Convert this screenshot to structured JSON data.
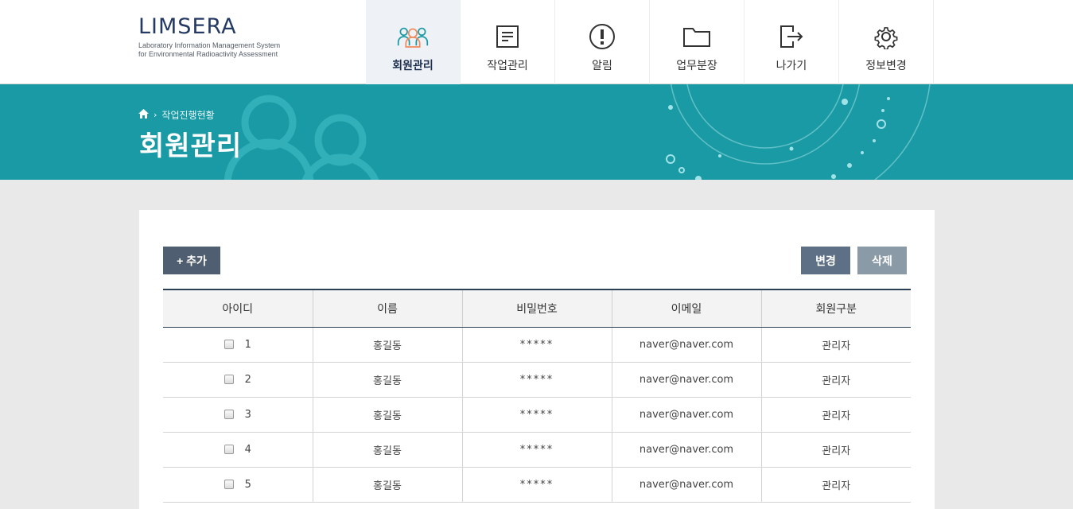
{
  "logo": {
    "title": "LIMSERA",
    "subtitle_line1": "Laboratory Information Management System",
    "subtitle_line2": "for Environmental Radioactivity Assessment"
  },
  "nav": [
    {
      "label": "회원관리",
      "icon": "users-icon",
      "active": true
    },
    {
      "label": "작업관리",
      "icon": "document-icon",
      "active": false
    },
    {
      "label": "알림",
      "icon": "alert-icon",
      "active": false
    },
    {
      "label": "업무분장",
      "icon": "folder-icon",
      "active": false
    },
    {
      "label": "나가기",
      "icon": "logout-icon",
      "active": false
    },
    {
      "label": "정보변경",
      "icon": "gear-icon",
      "active": false
    }
  ],
  "breadcrumb": {
    "home_icon": "home-icon",
    "current": "작업진행현황"
  },
  "page_title": "회원관리",
  "toolbar": {
    "add_label": "+ 추가",
    "edit_label": "변경",
    "delete_label": "삭제"
  },
  "table": {
    "headers": [
      "아이디",
      "이름",
      "비밀번호",
      "이메일",
      "회원구분"
    ],
    "rows": [
      {
        "id": "1",
        "name": "홍길동",
        "password": "*****",
        "email": "naver@naver.com",
        "type": "관리자"
      },
      {
        "id": "2",
        "name": "홍길동",
        "password": "*****",
        "email": "naver@naver.com",
        "type": "관리자"
      },
      {
        "id": "3",
        "name": "홍길동",
        "password": "*****",
        "email": "naver@naver.com",
        "type": "관리자"
      },
      {
        "id": "4",
        "name": "홍길동",
        "password": "*****",
        "email": "naver@naver.com",
        "type": "관리자"
      },
      {
        "id": "5",
        "name": "홍길동",
        "password": "*****",
        "email": "naver@naver.com",
        "type": "관리자"
      }
    ]
  },
  "colors": {
    "accent": "#1a9aa4",
    "navy": "#243a63",
    "button_dark": "#4f5f71"
  }
}
